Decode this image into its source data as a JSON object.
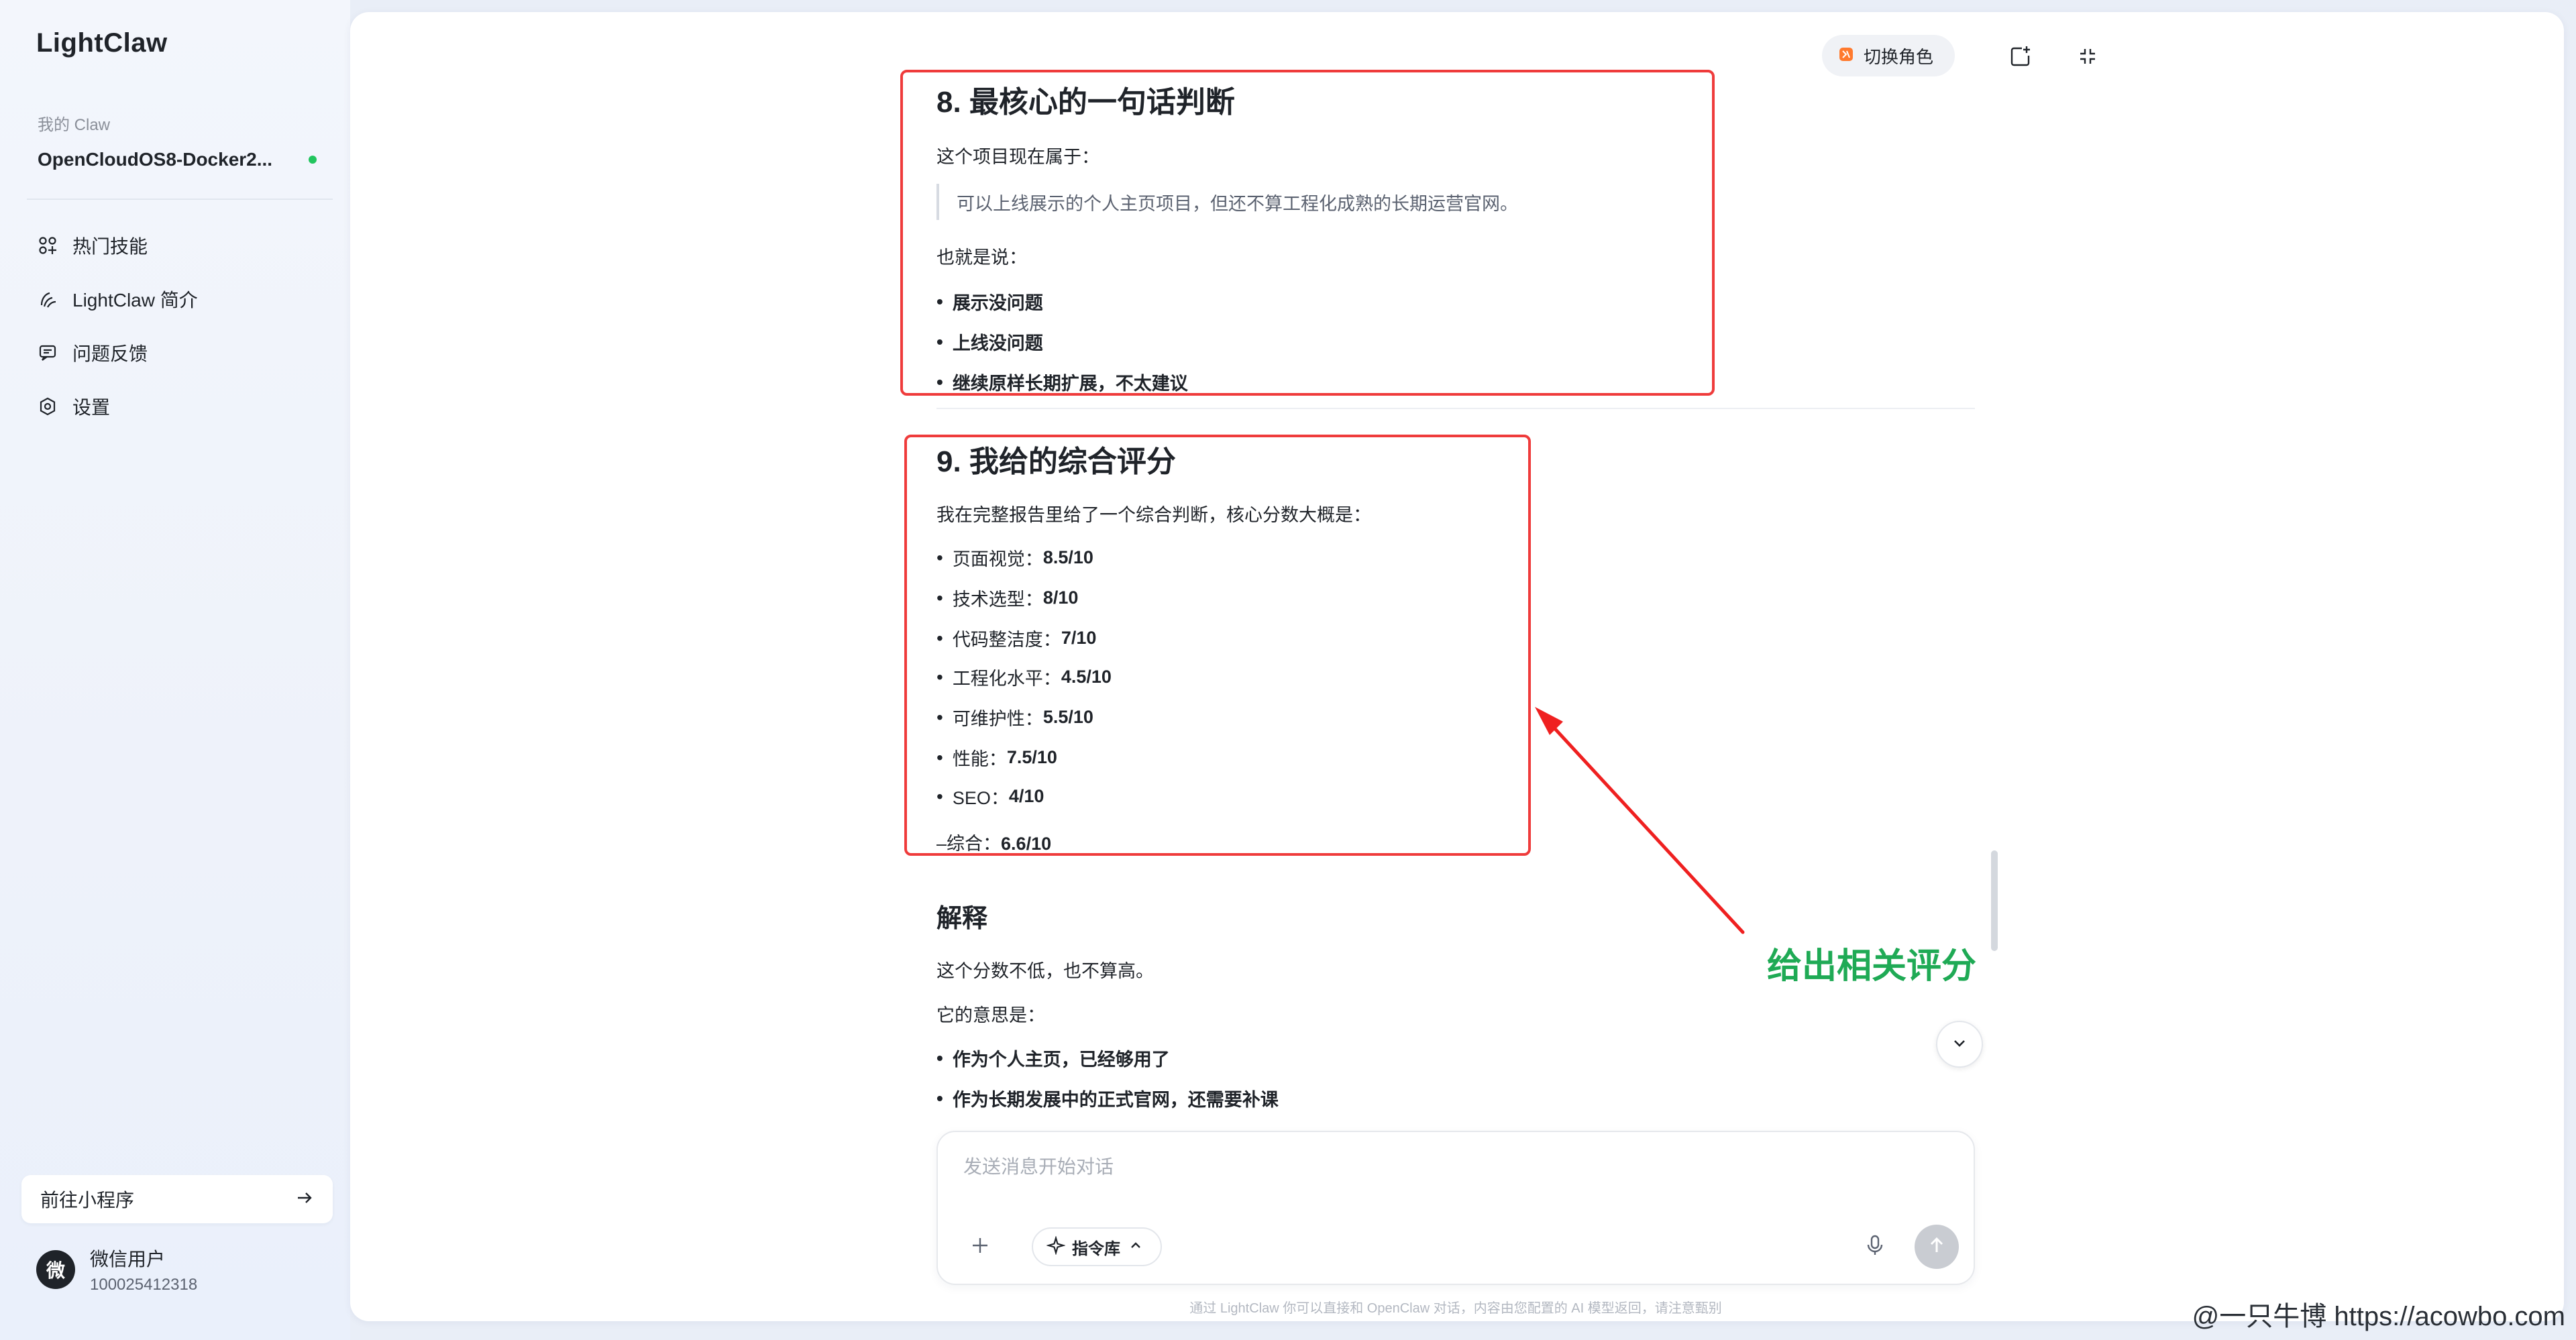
{
  "sidebar": {
    "brand": "LightClaw",
    "my_claw_label": "我的 Claw",
    "instance_name": "OpenCloudOS8-Docker2...",
    "nav": [
      {
        "label": "热门技能",
        "icon": "skills-icon"
      },
      {
        "label": "LightClaw 简介",
        "icon": "claw-icon"
      },
      {
        "label": "问题反馈",
        "icon": "feedback-icon"
      },
      {
        "label": "设置",
        "icon": "settings-icon"
      }
    ],
    "mini_program_label": "前往小程序",
    "user": {
      "avatar_text": "微",
      "name": "微信用户",
      "id": "100025412318"
    }
  },
  "topbar": {
    "switch_role_label": "切换角色"
  },
  "content": {
    "s8": {
      "title": "8. 最核心的一句话判断",
      "intro": "这个项目现在属于：",
      "quote": "可以上线展示的个人主页项目，但还不算工程化成熟的长期运营官网。",
      "also": "也就是说：",
      "bullets": [
        "展示没问题",
        "上线没问题",
        "继续原样长期扩展，不太建议"
      ]
    },
    "s9": {
      "title": "9. 我给的综合评分",
      "intro": "我在完整报告里给了一个综合判断，核心分数大概是：",
      "scores": [
        {
          "label": "页面视觉：",
          "value": "8.5/10"
        },
        {
          "label": "技术选型：",
          "value": "8/10"
        },
        {
          "label": "代码整洁度：",
          "value": "7/10"
        },
        {
          "label": "工程化水平：",
          "value": "4.5/10"
        },
        {
          "label": "可维护性：",
          "value": "5.5/10"
        },
        {
          "label": "性能：",
          "value": "7.5/10"
        },
        {
          "label": "SEO：",
          "value": "4/10"
        }
      ],
      "total_label": "–综合：",
      "total_value": "6.6/10"
    },
    "explain": {
      "title": "解释",
      "p1": "这个分数不低，也不算高。",
      "p2": "它的意思是：",
      "bullets": [
        "作为个人主页，已经够用了",
        "作为长期发展中的正式官网，还需要补课"
      ]
    }
  },
  "annotation": "给出相关评分",
  "composer": {
    "placeholder": "发送消息开始对话",
    "cmd_label": "指令库",
    "disclaimer": "通过 LightClaw 你可以直接和 OpenClaw 对话，内容由您配置的 AI 模型返回，请注意甄别"
  },
  "watermark": "@一只牛博 https://acowbo.com",
  "colors": {
    "highlight_red": "#ef3b3b",
    "annotation_green": "#1faa55",
    "online_green": "#22c55e"
  }
}
